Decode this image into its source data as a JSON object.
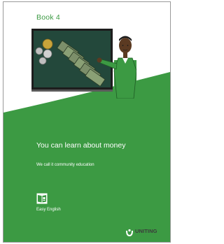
{
  "cover": {
    "book_label": "Book  4",
    "title": "You can learn about money",
    "subtitle": "We call it community education",
    "format_label": "Easy English"
  },
  "logo": {
    "name": "UNITING",
    "sub": "COMMUNITIES"
  },
  "colors": {
    "brand_green": "#3c9a43",
    "board": "#23483b",
    "board_frame": "#1d1d1d"
  },
  "icons": {
    "illustration": "teacher-at-board-with-money-icon",
    "easy_english": "open-book-icon",
    "logo": "uniting-communities-icon"
  }
}
